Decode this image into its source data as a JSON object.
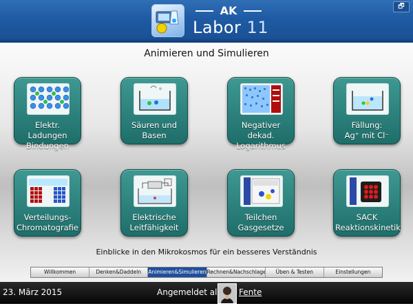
{
  "header": {
    "logo_top": "AK",
    "logo_labor": "Labor",
    "logo_version": "11",
    "restore_glyph": "🗗"
  },
  "main": {
    "title": "Animieren und Simulieren",
    "tagline": "Einblicke in den Mikrokosmos für ein besseres Verständnis",
    "tiles": [
      {
        "label_1": "Elektr. Ladungen",
        "label_2": "Bindungen"
      },
      {
        "label_1": "Säuren und",
        "label_2": "Basen"
      },
      {
        "label_1": "Negativer dekad.",
        "label_2": "Logarithmus"
      },
      {
        "label_1": "Fällung:",
        "label_2": "Ag⁺ mit Cl⁻"
      },
      {
        "label_1": "Verteilungs-",
        "label_2": "Chromatografie"
      },
      {
        "label_1": "Elektrische",
        "label_2": "Leitfähigkeit"
      },
      {
        "label_1": "Teilchen",
        "label_2": "Gasgesetze"
      },
      {
        "label_1": "SACK",
        "label_2": "Reaktionskinetik"
      }
    ]
  },
  "tabs": [
    "Willkommen",
    "Denken&Daddeln",
    "Animieren&Simulieren",
    "Rechnen&Nachschlagen",
    "Üben & Testen",
    "Einstellungen"
  ],
  "active_tab_index": 2,
  "status": {
    "date": "23. März 2015",
    "logged_in_label": "Angemeldet als:",
    "user": "Fente"
  },
  "colors": {
    "header_blue": "#1e5aa3",
    "tile_teal": "#2a7f7a",
    "active_tab": "#1f4f9c",
    "statusbar": "#111111"
  }
}
